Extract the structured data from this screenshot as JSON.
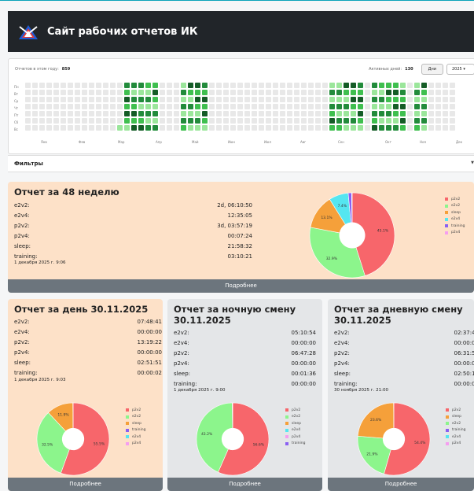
{
  "header": {
    "title": "Сайт рабочих отчетов ИК"
  },
  "heatmap": {
    "reports_label": "Отчетов в этом году:",
    "reports_value": "859",
    "active_label": "Активных дней:",
    "active_value": "130",
    "days_button": "Дни",
    "year": "2025",
    "weekdays": [
      "Пн",
      "Вт",
      "Ср",
      "Чт",
      "Пт",
      "Сб",
      "Вс"
    ],
    "months": [
      "Янв",
      "Фев",
      "Мар",
      "Апр",
      "Май",
      "Июн",
      "Июл",
      "Авг",
      "Сен",
      "Окт",
      "Ноя",
      "Дек"
    ],
    "palette": {
      "empty": "#e8e8e8",
      "l1": "#9be69b",
      "l2": "#3fbf4f",
      "l3": "#228b3b",
      "l4": "#145c26"
    }
  },
  "filters": {
    "label": "Фильтры",
    "caret": "▼"
  },
  "colors": {
    "p2v2": "#f7666b",
    "e2v2": "#8cf58c",
    "sleep": "#f5a03a",
    "e2v4": "#55e6f0",
    "training": "#8a60f2",
    "p2v4": "#f59ef0"
  },
  "week": {
    "title": "Отчет за 48 неделю",
    "rows": [
      {
        "k": "e2v2:",
        "v": "2d, 06:10:50"
      },
      {
        "k": "e2v4:",
        "v": "12:35:05"
      },
      {
        "k": "p2v2:",
        "v": "3d, 03:57:19"
      },
      {
        "k": "p2v4:",
        "v": "00:07:24"
      },
      {
        "k": "sleep:",
        "v": "21:58:32"
      },
      {
        "k": "training:",
        "v": "03:10:21"
      }
    ],
    "date": "1 декабря 2025 г. 9:06",
    "more": "Подробнее",
    "legend": [
      "p2v2",
      "e2v2",
      "sleep",
      "e2v4",
      "training",
      "p2v4"
    ],
    "chart_data": {
      "type": "pie",
      "labels": [
        "p2v2",
        "e2v2",
        "sleep",
        "e2v4",
        "training",
        "p2v4"
      ],
      "values": [
        45.1,
        32.9,
        13.1,
        7.4,
        1.3,
        0.2
      ],
      "slice_labels": [
        "45.1%",
        "32.9%",
        "13.1%",
        "7.4%",
        "",
        ""
      ]
    }
  },
  "day": {
    "title": "Отчет за день 30.11.2025",
    "rows": [
      {
        "k": "e2v2:",
        "v": "07:48:41"
      },
      {
        "k": "e2v4:",
        "v": "00:00:00"
      },
      {
        "k": "p2v2:",
        "v": "13:19:22"
      },
      {
        "k": "p2v4:",
        "v": "00:00:00"
      },
      {
        "k": "sleep:",
        "v": "02:51:51"
      },
      {
        "k": "training:",
        "v": "00:00:02"
      }
    ],
    "date": "1 декабря 2025 г. 9:03",
    "more": "Подробнее",
    "legend": [
      "p2v2",
      "e2v2",
      "sleep",
      "training",
      "e2v4",
      "p2v4"
    ],
    "chart_data": {
      "type": "pie",
      "labels": [
        "p2v2",
        "e2v2",
        "sleep",
        "training",
        "e2v4",
        "p2v4"
      ],
      "values": [
        55.5,
        32.5,
        11.9,
        0.1,
        0,
        0
      ],
      "slice_labels": [
        "55.5%",
        "32.5%",
        "11.9%",
        "",
        "",
        ""
      ]
    }
  },
  "night": {
    "title": "Отчет за ночную смену 30.11.2025",
    "rows": [
      {
        "k": "e2v2:",
        "v": "05:10:54"
      },
      {
        "k": "e2v4:",
        "v": "00:00:00"
      },
      {
        "k": "p2v2:",
        "v": "06:47:28"
      },
      {
        "k": "p2v4:",
        "v": "00:00:00"
      },
      {
        "k": "sleep:",
        "v": "00:01:36"
      },
      {
        "k": "training:",
        "v": "00:00:00"
      }
    ],
    "date": "1 декабря 2025 г. 9:00",
    "more": "Подробнее",
    "legend": [
      "p2v2",
      "e2v2",
      "sleep",
      "e2v4",
      "p2v4",
      "training"
    ],
    "chart_data": {
      "type": "pie",
      "labels": [
        "p2v2",
        "e2v2",
        "sleep",
        "e2v4",
        "p2v4",
        "training"
      ],
      "values": [
        56.6,
        43.2,
        0.2,
        0,
        0,
        0
      ],
      "slice_labels": [
        "56.6%",
        "43.2%",
        "",
        "",
        "",
        ""
      ]
    }
  },
  "dayshift": {
    "title": "Отчет за дневную смену 30.11.2025",
    "rows": [
      {
        "k": "e2v2:",
        "v": "02:37:47"
      },
      {
        "k": "e2v4:",
        "v": "00:00:00"
      },
      {
        "k": "p2v2:",
        "v": "06:31:54"
      },
      {
        "k": "p2v4:",
        "v": "00:00:00"
      },
      {
        "k": "sleep:",
        "v": "02:50:15"
      },
      {
        "k": "training:",
        "v": "00:00:02"
      }
    ],
    "date": "30 ноября 2025 г. 21:00",
    "more": "Подробнее",
    "legend": [
      "p2v2",
      "sleep",
      "e2v2",
      "training",
      "e2v4",
      "p2v4"
    ],
    "chart_data": {
      "type": "pie",
      "labels": [
        "p2v2",
        "e2v2",
        "sleep",
        "training",
        "e2v4",
        "p2v4"
      ],
      "values": [
        54.4,
        21.9,
        23.6,
        0.1,
        0,
        0
      ],
      "slice_labels": [
        "54.4%",
        "21.9%",
        "23.6%",
        "",
        "",
        ""
      ]
    }
  }
}
